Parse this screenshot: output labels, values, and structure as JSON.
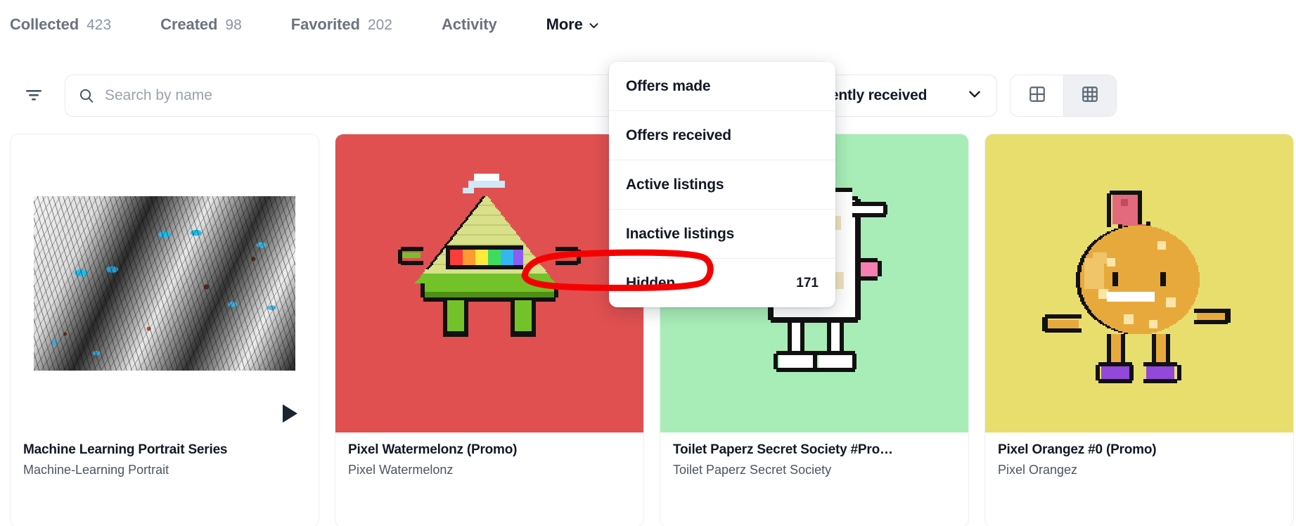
{
  "tabs": [
    {
      "label": "Collected",
      "count": "423",
      "active": false
    },
    {
      "label": "Created",
      "count": "98",
      "active": false
    },
    {
      "label": "Favorited",
      "count": "202",
      "active": false
    },
    {
      "label": "Activity",
      "count": "",
      "active": false
    },
    {
      "label": "More",
      "count": "",
      "active": true
    }
  ],
  "dropdown": {
    "items": [
      {
        "label": "Offers made",
        "count": ""
      },
      {
        "label": "Offers received",
        "count": ""
      },
      {
        "label": "Active listings",
        "count": ""
      },
      {
        "label": "Inactive listings",
        "count": ""
      },
      {
        "label": "Hidden",
        "count": "171"
      }
    ],
    "highlighted_item": "Hidden",
    "highlight_color": "#f50000"
  },
  "toolbar": {
    "filter_icon": "filter-icon",
    "search": {
      "icon": "search-icon",
      "placeholder": "Search by name",
      "value": ""
    },
    "sort": {
      "value": "Recently received",
      "icon": "chevron-down-icon"
    },
    "views": [
      {
        "name": "grid-large-view",
        "icon": "grid-2x2-icon",
        "active": false
      },
      {
        "name": "grid-small-view",
        "icon": "grid-3x3-icon",
        "active": true
      }
    ]
  },
  "cards": [
    {
      "title": "Machine Learning Portrait Series",
      "collection": "Machine-Learning Portrait",
      "bg": "#ffffff",
      "art": "portrait-collage",
      "has_play_badge": true
    },
    {
      "title": "Pixel Watermelonz (Promo)",
      "collection": "Pixel Watermelonz",
      "bg": "#e05050",
      "art": "pixel-watermelon",
      "has_play_badge": false
    },
    {
      "title": "Toilet Paperz Secret Society #Pro…",
      "collection": "Toilet Paperz Secret Society",
      "bg": "#a8edb8",
      "art": "pixel-toiletpaper",
      "has_play_badge": false
    },
    {
      "title": "Pixel Orangez #0 (Promo)",
      "collection": "Pixel Orangez",
      "bg": "#e8de6e",
      "art": "pixel-orange",
      "has_play_badge": false
    }
  ]
}
